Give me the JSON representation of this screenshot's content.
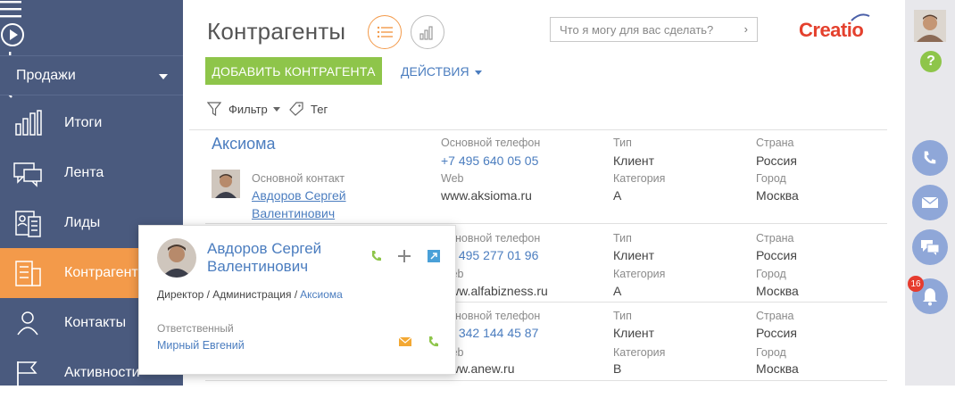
{
  "sidebar": {
    "section": "Продажи",
    "items": [
      {
        "label": "Итоги"
      },
      {
        "label": "Лента"
      },
      {
        "label": "Лиды"
      },
      {
        "label": "Контрагенты"
      },
      {
        "label": "Контакты"
      },
      {
        "label": "Активности"
      }
    ]
  },
  "header": {
    "title": "Контрагенты",
    "search_placeholder": "Что я могу для вас сделать?",
    "brand": "Creatio",
    "add_label": "ДОБАВИТЬ КОНТРАГЕНТА",
    "actions_label": "ДЕЙСТВИЯ",
    "filter_label": "Фильтр",
    "tag_label": "Тег"
  },
  "labels": {
    "phone": "Основной телефон",
    "web": "Web",
    "type": "Тип",
    "category": "Категория",
    "country": "Страна",
    "city": "Город",
    "contact": "Основной контакт"
  },
  "rows": [
    {
      "name": "Аксиома",
      "phone": "+7 495 640 05 05",
      "web": "www.aksioma.ru",
      "type": "Клиент",
      "category": "A",
      "country": "Россия",
      "city": "Москва",
      "contact_line1": "Авдоров Сергей",
      "contact_line2": "Валентинович"
    },
    {
      "phone": "+7 495 277 01 96",
      "web": "www.alfabizness.ru",
      "type": "Клиент",
      "category": "A",
      "country": "Россия",
      "city": "Москва",
      "web_partial": "b",
      "phone_partial": "495 277 01 96",
      "web_val_partial": "www.alfabizness.ru"
    },
    {
      "phone": "+7 342 144 45 87",
      "web": "www.anew.ru",
      "type": "Клиент",
      "category": "B",
      "country": "Россия",
      "city": "Москва",
      "phone_partial": "342 144 45 87",
      "web_partial": "b",
      "web_val_partial": "www.anew.ru"
    }
  ],
  "popup": {
    "name_line1": "Авдоров Сергей",
    "name_line2": "Валентинович",
    "role": "Директор / Администрация /",
    "company": "Аксиома",
    "responsible_label": "Ответственный",
    "responsible": "Мирный Евгений"
  },
  "right_panel": {
    "help": "?",
    "notifications": "16"
  },
  "colors": {
    "sidebar": "#4a5a7e",
    "active": "#f39a4a",
    "add_button": "#8ec54a",
    "link": "#4b7dbf",
    "brand": "#e4402d"
  }
}
